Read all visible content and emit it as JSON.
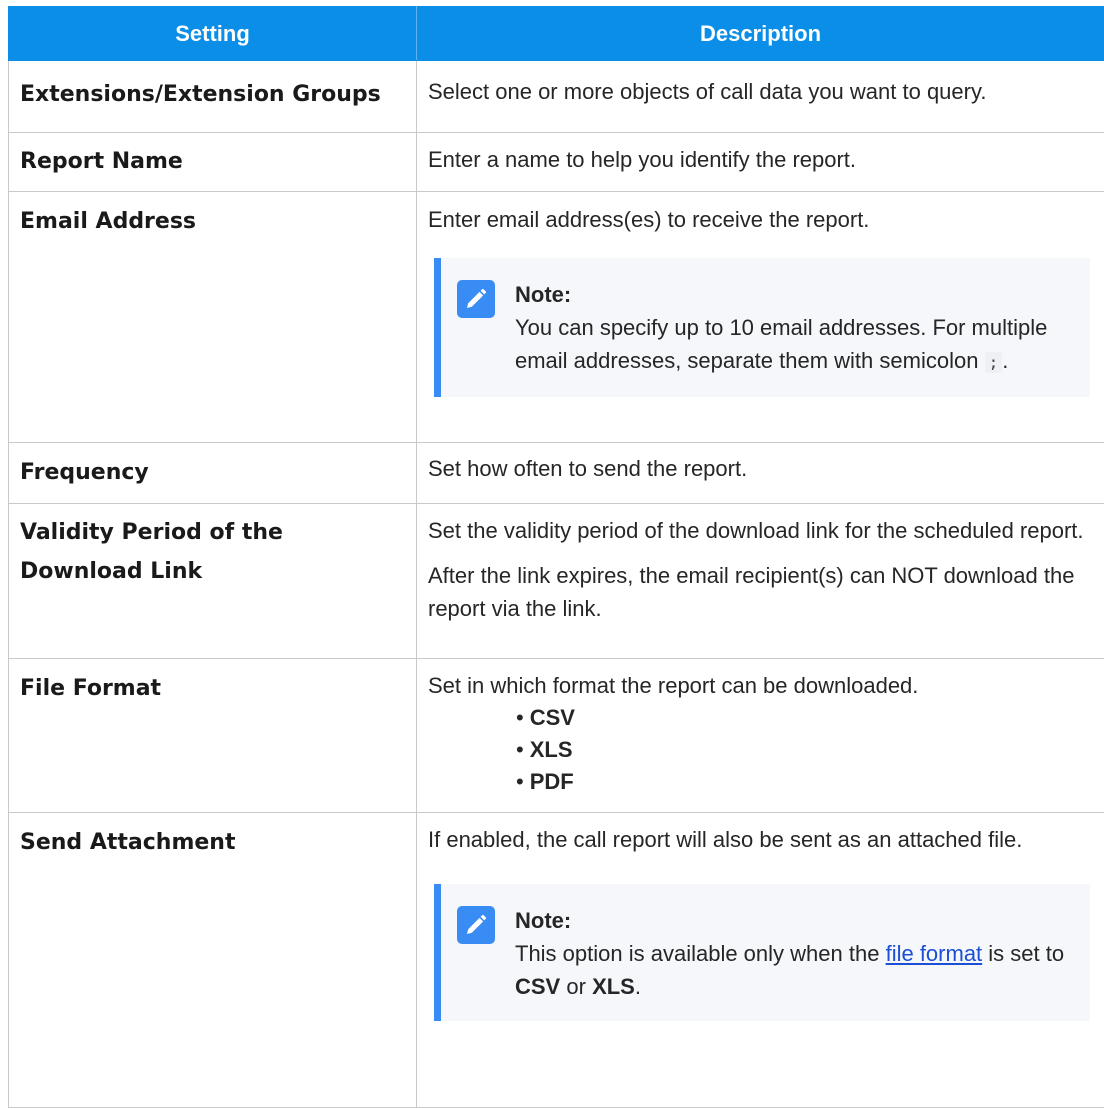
{
  "table": {
    "headers": {
      "setting": "Setting",
      "description": "Description"
    },
    "rows": {
      "extensions": {
        "name": "Extensions/Extension Groups",
        "desc": "Select one or more objects of call data you want to query."
      },
      "report_name": {
        "name": "Report Name",
        "desc": "Enter a name to help you identify the report."
      },
      "email": {
        "name": "Email Address",
        "desc": "Enter email address(es) to receive the report.",
        "note": {
          "title": "Note:",
          "text_before": "You can specify up to 10 email addresses. For multiple email addresses, separate them with semicolon",
          "code": ";",
          "text_after": "."
        }
      },
      "frequency": {
        "name": "Frequency",
        "desc": "Set how often to send the report."
      },
      "validity": {
        "name_line1": "Validity Period of the",
        "name_line2": "Download Link",
        "desc_p1": "Set the validity period of the download link for the scheduled report.",
        "desc_p2": "After the link expires, the email recipient(s) can NOT download the report via the link."
      },
      "file_format": {
        "name": "File Format",
        "desc": "Set in which format the report can be downloaded.",
        "options": [
          "CSV",
          "XLS",
          "PDF"
        ]
      },
      "attachment": {
        "name": "Send Attachment",
        "desc": "If enabled, the call report will also be sent as an attached file.",
        "note": {
          "title": "Note:",
          "text_1": "This option is available only when the",
          "link": "file format",
          "text_2": "is set to",
          "fmt1": "CSV",
          "text_3": "or",
          "fmt2": "XLS",
          "text_4": "."
        }
      }
    }
  },
  "colors": {
    "header_bg": "#0a8ee8",
    "note_accent": "#3a8cf5",
    "note_bg": "#f5f7fa",
    "link": "#1a4fd6"
  },
  "icons": {
    "note": "pencil-note-icon"
  }
}
